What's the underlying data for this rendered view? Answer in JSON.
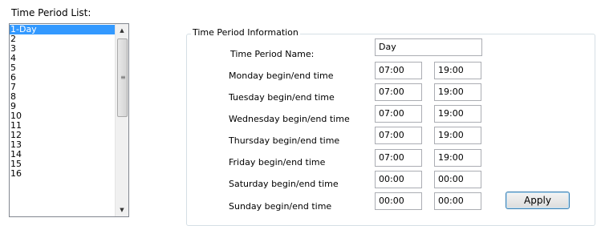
{
  "list_title": "Time Period List:",
  "list_items": [
    "1-Day",
    "2",
    "3",
    "4",
    "5",
    "6",
    "7",
    "8",
    "9",
    "10",
    "11",
    "12",
    "13",
    "14",
    "15",
    "16"
  ],
  "selected_index": 0,
  "group_title": "Time Period Information",
  "name_label": "Time Period Name:",
  "name_value": "Day",
  "days": [
    {
      "label": "Monday begin/end time",
      "begin": "07:00",
      "end": "19:00"
    },
    {
      "label": "Tuesday begin/end time",
      "begin": "07:00",
      "end": "19:00"
    },
    {
      "label": "Wednesday begin/end time",
      "begin": "07:00",
      "end": "19:00"
    },
    {
      "label": "Thursday begin/end time",
      "begin": "07:00",
      "end": "19:00"
    },
    {
      "label": "Friday begin/end time",
      "begin": "07:00",
      "end": "19:00"
    },
    {
      "label": "Saturday begin/end time",
      "begin": "00:00",
      "end": "00:00"
    },
    {
      "label": "Sunday begin/end time",
      "begin": "00:00",
      "end": "00:00"
    }
  ],
  "apply_label": "Apply"
}
